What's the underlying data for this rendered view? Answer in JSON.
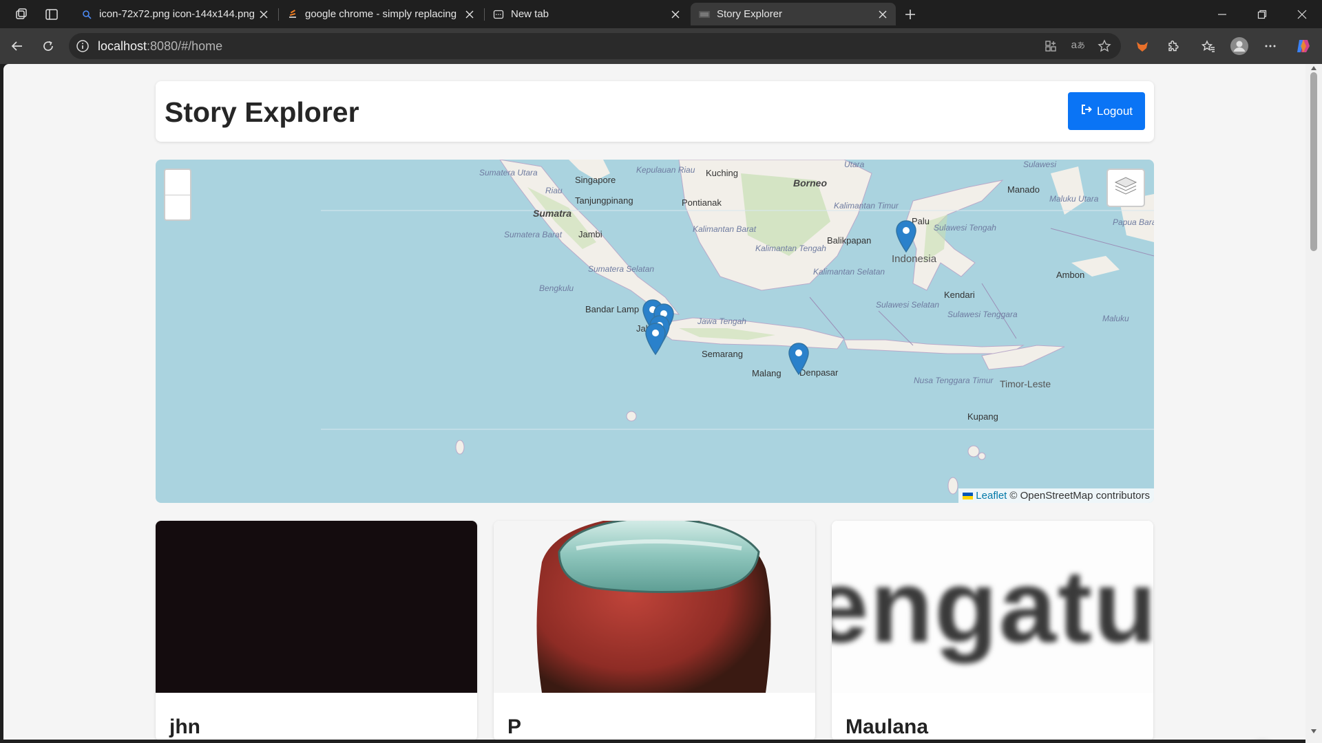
{
  "browser": {
    "tabs": [
      {
        "title": "icon-72x72.png icon-144x144.png",
        "favicon": "search-icon",
        "active": false
      },
      {
        "title": "google chrome - simply replacing",
        "favicon": "stackoverflow-icon",
        "active": false
      },
      {
        "title": "New tab",
        "favicon": "newtab-icon",
        "active": false
      },
      {
        "title": "Story Explorer",
        "favicon": "page-icon",
        "active": true
      }
    ],
    "url_host": "localhost",
    "url_path": ":8080/#/home"
  },
  "app": {
    "title": "Story Explorer",
    "logout_label": "Logout",
    "accent": "#0a74f5"
  },
  "map": {
    "attribution_link": "Leaflet",
    "attribution_text": "© OpenStreetMap contributors",
    "labels": {
      "singapore": "Singapore",
      "tanjungpinang": "Tanjungpinang",
      "sumatra": "Sumatra",
      "jambi": "Jambi",
      "bandar_lampung": "Bandar Lamp",
      "kuching": "Kuching",
      "borneo": "Borneo",
      "pontianak": "Pontianak",
      "balikpapan": "Balikpapan",
      "manado": "Manado",
      "palu": "Palu",
      "indonesia": "Indonesia",
      "ambon": "Ambon",
      "kendari": "Kendari",
      "semarang": "Semarang",
      "malang": "Malang",
      "denpasar": "Denpasar",
      "timor_leste": "Timor-Leste",
      "kupang": "Kupang",
      "jakarta": "Jak",
      "sumatera_utara": "Sumatera Utara",
      "riau": "Riau",
      "kepulauan_riau": "Kepulauan Riau",
      "sumatera_barat": "Sumatera Barat",
      "sumatera_selatan": "Sumatera Selatan",
      "bengkulu": "Bengkulu",
      "kalimantan_barat": "Kalimantan Barat",
      "kalimantan_tengah": "Kalimantan Tengah",
      "kalimantan_selatan": "Kalimantan Selatan",
      "kalimantan_timur": "Kalimantan Timur",
      "sulawesi_tengah": "Sulawesi Tengah",
      "sulawesi_selatan": "Sulawesi Selatan",
      "sulawesi_tenggara": "Sulawesi Tenggara",
      "jawa_tengah": "Jawa Tengah",
      "nusa_tenggara_timur": "Nusa Tenggara Timur",
      "maluku": "Maluku",
      "maluku_utara": "Maluku Utara",
      "papua_barat_daya": "Papua Barat Daya",
      "sulawesi": "Sulawesi",
      "utara": "Utara"
    }
  },
  "stories": [
    {
      "name": "jhn",
      "image": "dark photo"
    },
    {
      "name": "P",
      "image": "red figure"
    },
    {
      "name": "Maulana",
      "image": "blurred text"
    }
  ]
}
